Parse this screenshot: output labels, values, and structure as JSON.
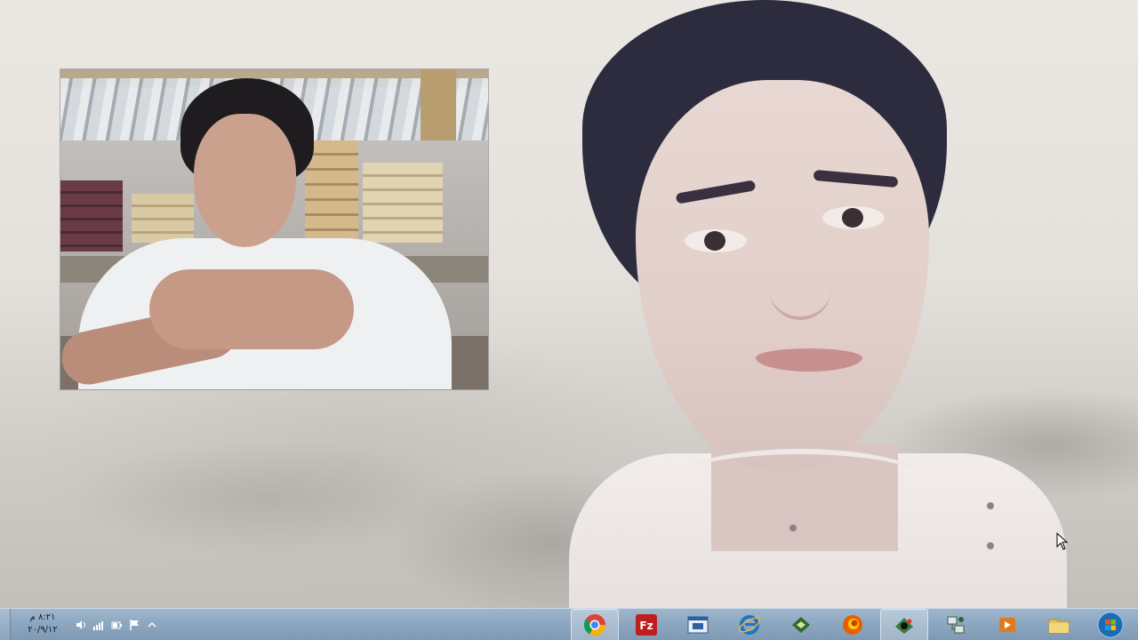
{
  "desktop": {
    "wallpaper": "portrait-wallpaper"
  },
  "video_window": {
    "content": "webcam-video"
  },
  "taskbar": {
    "clock": {
      "time": "٨:٢١ م",
      "date": "٢٠/٩/١٢"
    },
    "tray_icons": [
      "speaker-icon",
      "network-icon",
      "power-icon",
      "flag-icon",
      "show-hidden-icon"
    ],
    "apps": [
      {
        "name": "chrome-icon",
        "color": "#db4437"
      },
      {
        "name": "filezilla-icon",
        "color": "#bf1e1e"
      },
      {
        "name": "app-window-icon",
        "color": "#2f5f9e"
      },
      {
        "name": "internet-explorer-icon",
        "color": "#1f74c9"
      },
      {
        "name": "green-app-icon",
        "color": "#2d6b2a"
      },
      {
        "name": "firefox-icon",
        "color": "#e66000"
      },
      {
        "name": "media-app-icon",
        "color": "#3a7a3a"
      },
      {
        "name": "network-tool-icon",
        "color": "#3b5f3b"
      },
      {
        "name": "media-player-icon",
        "color": "#e07a1f"
      },
      {
        "name": "folder-icon",
        "color": "#e8c25a"
      },
      {
        "name": "windows-start-icon",
        "color": "#1c6bb5"
      }
    ]
  }
}
